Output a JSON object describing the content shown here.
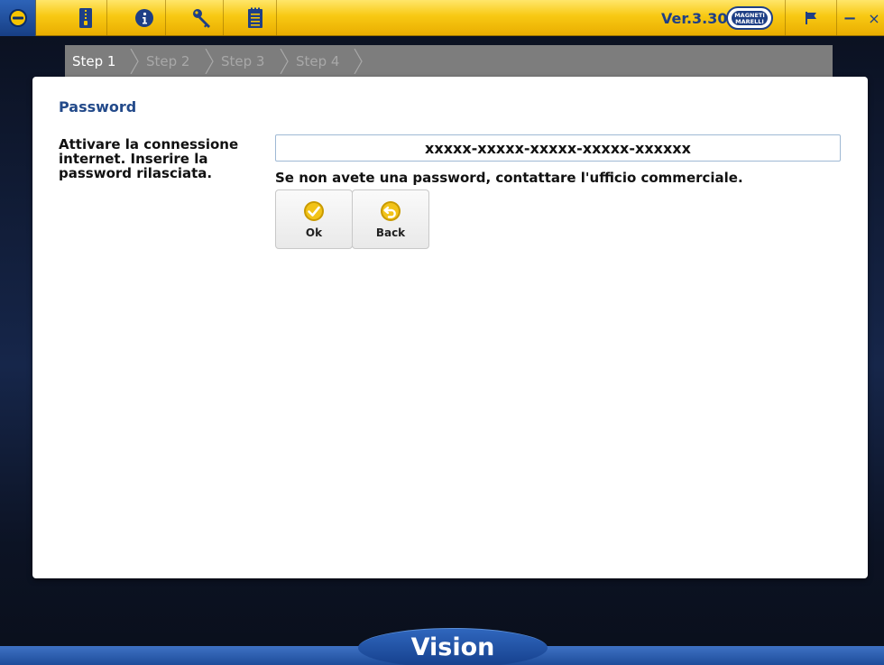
{
  "toolbar": {
    "icons": [
      "home-icon",
      "zipper-file-icon",
      "info-icon",
      "key-icon",
      "notepad-icon"
    ],
    "version": "Ver.3.30",
    "brand": "MAGNETI MARELLI",
    "flag_icon": "flag-icon",
    "minimize": "−",
    "close": "×",
    "colors": {
      "bar": "#f8c913",
      "accent": "#1e3f86"
    }
  },
  "steps": [
    {
      "label": "Step 1",
      "active": true
    },
    {
      "label": "Step 2",
      "active": false
    },
    {
      "label": "Step 3",
      "active": false
    },
    {
      "label": "Step 4",
      "active": false
    }
  ],
  "card": {
    "title": "Password",
    "instruction": "Attivare la connessione internet. Inserire la password rilasciata.",
    "password_value": "xxxxx-xxxxx-xxxxx-xxxxx-xxxxxx",
    "hint": "Se non avete una password, contattare l'ufficio commerciale.",
    "ok_label": "Ok",
    "back_label": "Back"
  },
  "footer": {
    "app_name": "Vision"
  }
}
